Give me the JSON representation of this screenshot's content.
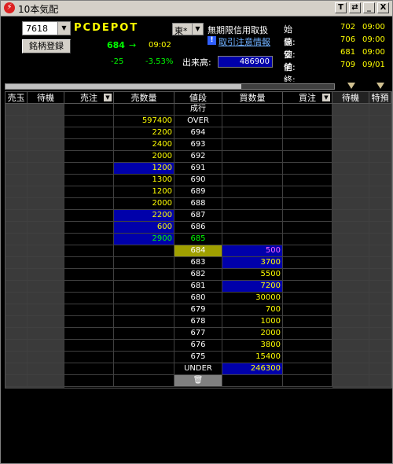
{
  "window": {
    "title": "10本気配"
  },
  "titlebar_buttons": [
    "T",
    "⇄",
    "_",
    "X"
  ],
  "stock": {
    "code": "7618",
    "name": "PCDEPOT",
    "register_label": "銘柄登録",
    "price": "684",
    "arrow": "→",
    "time": "09:02",
    "change": "-25",
    "change_pct": "-3.53%",
    "volume_label": "出来高:",
    "volume": "486900",
    "market": "東*",
    "credit_text": "無期限信用取扱",
    "notice_link": "取引注意情報"
  },
  "ohlc": [
    {
      "label": "始値:",
      "value": "702",
      "time": "09:00"
    },
    {
      "label": "高値:",
      "value": "706",
      "time": "09:00"
    },
    {
      "label": "安値:",
      "value": "681",
      "time": "09:00"
    },
    {
      "label": "前終:",
      "value": "709",
      "time": "09/01"
    }
  ],
  "columns": [
    "売玉",
    "待機",
    "売注",
    "売数量",
    "値段",
    "買数量",
    "買注",
    "待機",
    "特預"
  ],
  "rows": [
    {
      "sell": "",
      "price": "成行",
      "buy": ""
    },
    {
      "sell": "597400",
      "price": "OVER",
      "buy": ""
    },
    {
      "sell": "2200",
      "price": "694",
      "buy": ""
    },
    {
      "sell": "2400",
      "price": "693",
      "buy": ""
    },
    {
      "sell": "2000",
      "price": "692",
      "buy": ""
    },
    {
      "sell": "1200",
      "price": "691",
      "buy": "",
      "sell_hl": true
    },
    {
      "sell": "1300",
      "price": "690",
      "buy": ""
    },
    {
      "sell": "1200",
      "price": "689",
      "buy": ""
    },
    {
      "sell": "2000",
      "price": "688",
      "buy": ""
    },
    {
      "sell": "2200",
      "price": "687",
      "buy": "",
      "sell_hl": true
    },
    {
      "sell": "600",
      "price": "686",
      "buy": "",
      "sell_hl": true
    },
    {
      "sell": "2900",
      "price": "685",
      "buy": "",
      "sell_hl": true,
      "sell_color": "#00ff00",
      "price_color": "#00ff00"
    },
    {
      "sell": "",
      "price": "684",
      "buy": "500",
      "price_hl": true,
      "buy_hl": true,
      "buy_color": "#ff66ff"
    },
    {
      "sell": "",
      "price": "683",
      "buy": "3700",
      "buy_hl": true
    },
    {
      "sell": "",
      "price": "682",
      "buy": "5500"
    },
    {
      "sell": "",
      "price": "681",
      "buy": "7200",
      "buy_hl": true
    },
    {
      "sell": "",
      "price": "680",
      "buy": "30000"
    },
    {
      "sell": "",
      "price": "679",
      "buy": "700"
    },
    {
      "sell": "",
      "price": "678",
      "buy": "1000"
    },
    {
      "sell": "",
      "price": "677",
      "buy": "2000"
    },
    {
      "sell": "",
      "price": "676",
      "buy": "3800"
    },
    {
      "sell": "",
      "price": "675",
      "buy": "15400"
    },
    {
      "sell": "",
      "price": "UNDER",
      "buy": "246300",
      "buy_hl": true,
      "price_color": "#ffffff"
    },
    {
      "sell": "",
      "price": "trash-icon",
      "buy": "",
      "trash": true
    }
  ],
  "colors": {
    "qty": "#ffff00",
    "price": "#ffffff",
    "highlight_blue": "#0000aa",
    "highlight_olive": "#a0a000"
  }
}
